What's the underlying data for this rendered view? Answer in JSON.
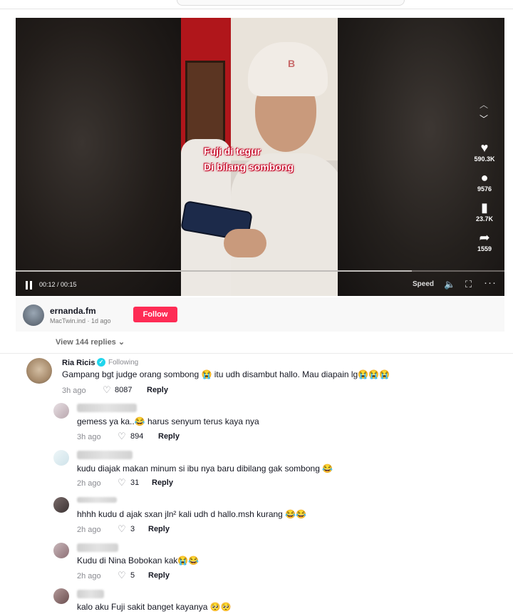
{
  "video": {
    "caption_lines": [
      "Fuji di tegur",
      "Di bilang sombong"
    ],
    "beanie_logo": "B",
    "progress": 0.81,
    "time": "00:12 / 00:15",
    "speed_label": "Speed",
    "actions": [
      {
        "icon": "heart-icon",
        "glyph": "♥",
        "count": "590.3K"
      },
      {
        "icon": "comment-icon",
        "glyph": "●",
        "count": "9576"
      },
      {
        "icon": "bookmark-icon",
        "glyph": "▮",
        "count": "23.7K"
      },
      {
        "icon": "share-icon",
        "glyph": "➦",
        "count": "1559"
      }
    ]
  },
  "author": {
    "name": "ernanda.fm",
    "meta": "MacTwin.ind · 1d ago",
    "follow_label": "Follow"
  },
  "view_replies": "View 144 replies ⌄",
  "top_comment": {
    "name": "Ria Ricis",
    "following": "Following",
    "text": "Gampang bgt judge orang sombong 😭 itu udh disambut hallo. Mau diapain lg😭😭😭",
    "time": "3h ago",
    "likes": "8087",
    "reply": "Reply"
  },
  "replies": [
    {
      "text": "gemess ya ka..😂 harus senyum terus kaya nya",
      "time": "3h ago",
      "likes": "894",
      "reply": "Reply"
    },
    {
      "text": "kudu diajak makan minum si ibu nya baru dibilang gak sombong 😂",
      "time": "2h ago",
      "likes": "31",
      "reply": "Reply"
    },
    {
      "text": "hhhh kudu d ajak sxan jln² kali udh d hallo.msh kurang 😂😂",
      "time": "2h ago",
      "likes": "3",
      "reply": "Reply"
    },
    {
      "text": "Kudu di Nina Bobokan kak😭😂",
      "time": "2h ago",
      "likes": "5",
      "reply": "Reply"
    },
    {
      "text": "kalo aku Fuji sakit banget kayanya 🥺🥺",
      "time": "",
      "likes": "",
      "reply": ""
    }
  ]
}
